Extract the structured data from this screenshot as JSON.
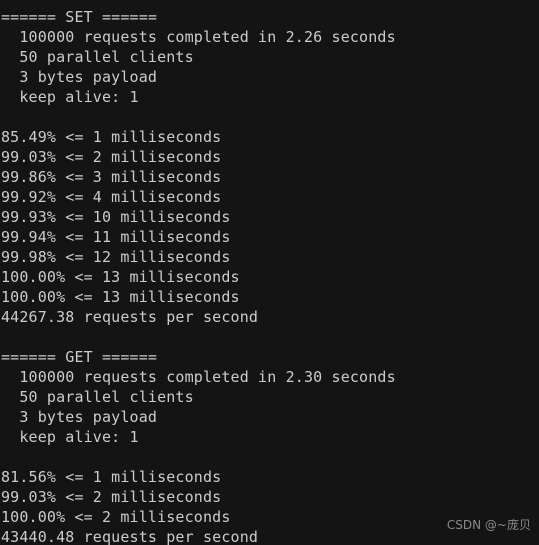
{
  "terminal": {
    "background_color": "#141414",
    "text_color": "#cccccc",
    "lines": [
      "====== SET ======",
      "  100000 requests completed in 2.26 seconds",
      "  50 parallel clients",
      "  3 bytes payload",
      "  keep alive: 1",
      "",
      "85.49% <= 1 milliseconds",
      "99.03% <= 2 milliseconds",
      "99.86% <= 3 milliseconds",
      "99.92% <= 4 milliseconds",
      "99.93% <= 10 milliseconds",
      "99.94% <= 11 milliseconds",
      "99.98% <= 12 milliseconds",
      "100.00% <= 13 milliseconds",
      "100.00% <= 13 milliseconds",
      "44267.38 requests per second",
      "",
      "====== GET ======",
      "  100000 requests completed in 2.30 seconds",
      "  50 parallel clients",
      "  3 bytes payload",
      "  keep alive: 1",
      "",
      "81.56% <= 1 milliseconds",
      "99.03% <= 2 milliseconds",
      "100.00% <= 2 milliseconds",
      "43440.48 requests per second"
    ]
  },
  "benchmark": {
    "set": {
      "header": "====== SET ======",
      "requests_completed": "100000",
      "duration_seconds": "2.26",
      "parallel_clients": "50",
      "payload_bytes": "3",
      "keep_alive": "1",
      "latency_distribution": [
        {
          "percent": "85.49%",
          "operator": "<=",
          "value": "1",
          "unit": "milliseconds"
        },
        {
          "percent": "99.03%",
          "operator": "<=",
          "value": "2",
          "unit": "milliseconds"
        },
        {
          "percent": "99.86%",
          "operator": "<=",
          "value": "3",
          "unit": "milliseconds"
        },
        {
          "percent": "99.92%",
          "operator": "<=",
          "value": "4",
          "unit": "milliseconds"
        },
        {
          "percent": "99.93%",
          "operator": "<=",
          "value": "10",
          "unit": "milliseconds"
        },
        {
          "percent": "99.94%",
          "operator": "<=",
          "value": "11",
          "unit": "milliseconds"
        },
        {
          "percent": "99.98%",
          "operator": "<=",
          "value": "12",
          "unit": "milliseconds"
        },
        {
          "percent": "100.00%",
          "operator": "<=",
          "value": "13",
          "unit": "milliseconds"
        },
        {
          "percent": "100.00%",
          "operator": "<=",
          "value": "13",
          "unit": "milliseconds"
        }
      ],
      "throughput": "44267.38 requests per second"
    },
    "get": {
      "header": "====== GET ======",
      "requests_completed": "100000",
      "duration_seconds": "2.30",
      "parallel_clients": "50",
      "payload_bytes": "3",
      "keep_alive": "1",
      "latency_distribution": [
        {
          "percent": "81.56%",
          "operator": "<=",
          "value": "1",
          "unit": "milliseconds"
        },
        {
          "percent": "99.03%",
          "operator": "<=",
          "value": "2",
          "unit": "milliseconds"
        },
        {
          "percent": "100.00%",
          "operator": "<=",
          "value": "2",
          "unit": "milliseconds"
        }
      ],
      "throughput": "43440.48 requests per second"
    }
  },
  "watermark": {
    "text": "CSDN @~庞贝",
    "color": "#8a8a8a"
  }
}
